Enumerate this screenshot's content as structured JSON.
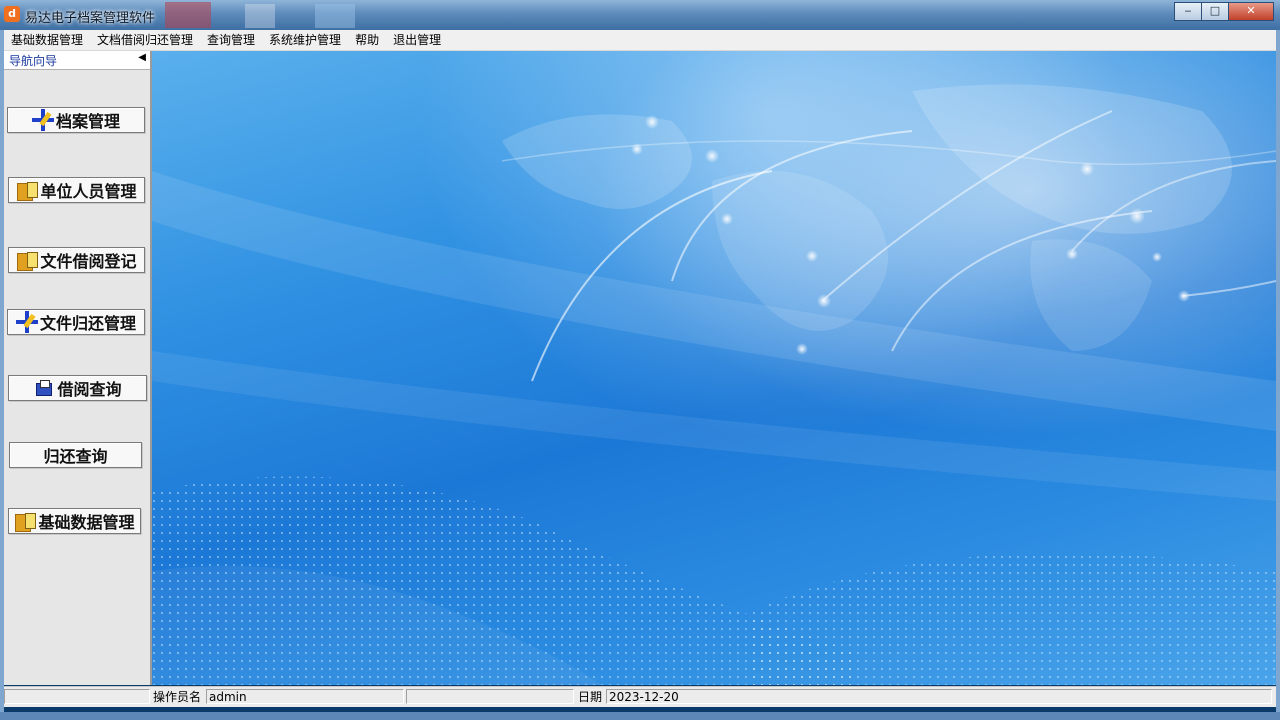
{
  "window": {
    "title": "易达电子档案管理软件",
    "icon": "app-logo-icon",
    "controls": [
      "minimize",
      "maximize",
      "close"
    ]
  },
  "menu": [
    "基础数据管理",
    "文档借阅归还管理",
    "查询管理",
    "系统维护管理",
    "帮助",
    "退出管理"
  ],
  "nav": {
    "title": "导航向导",
    "buttons": [
      {
        "label": "档案管理",
        "icon": "edit-arrows-icon"
      },
      {
        "label": "单位人员管理",
        "icon": "folder-edit-icon"
      },
      {
        "label": "文件借阅登记",
        "icon": "folder-edit-icon"
      },
      {
        "label": "文件归还管理",
        "icon": "edit-arrows-icon"
      },
      {
        "label": "借阅查询",
        "icon": "print-icon"
      },
      {
        "label": "归还查询",
        "icon": ""
      },
      {
        "label": "基础数据管理",
        "icon": "folder-edit-icon"
      }
    ]
  },
  "status": {
    "operator_label": "操作员名",
    "operator_value": "admin",
    "date_label": "日期",
    "date_value": "2023-12-20"
  },
  "colors": {
    "title_bar": "#5d8bbb",
    "background_blue": "#2f90e2",
    "nav_title": "#1a3aa0"
  }
}
